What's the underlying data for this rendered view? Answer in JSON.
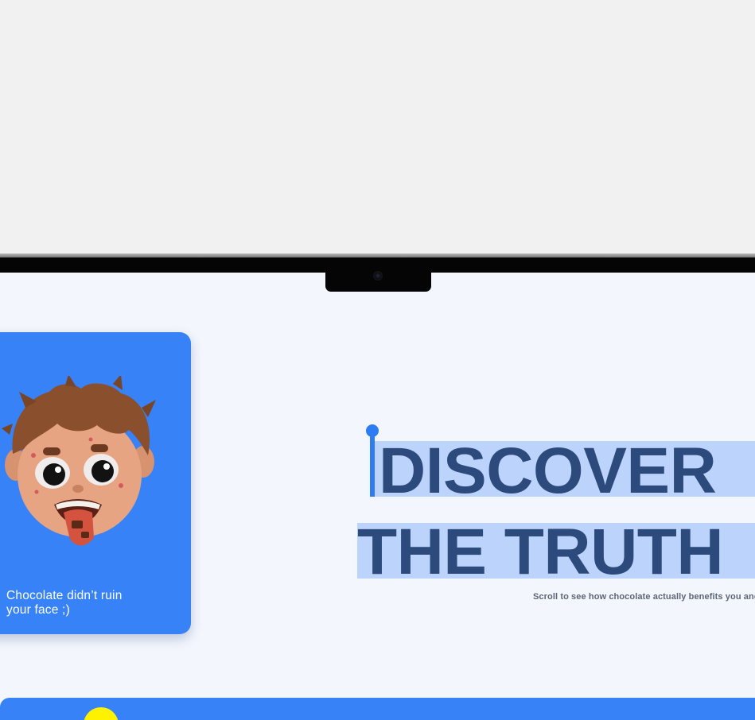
{
  "hero": {
    "line1": "DISCOVER",
    "line2": "THE TRUTH",
    "subtext": "Scroll to see how chocolate actually benefits you and y"
  },
  "card": {
    "caption_line1": "Chocolate didn’t ruin",
    "caption_line2": "your face ;)",
    "illustration": "cartoon-boy-with-chocolate-face"
  },
  "colors": {
    "accent_blue": "#3782f6",
    "heading_navy": "#2c4a7c",
    "highlight": "#bcd3fb",
    "screen_bg": "#f3f6fd",
    "yellow": "#fff200"
  }
}
